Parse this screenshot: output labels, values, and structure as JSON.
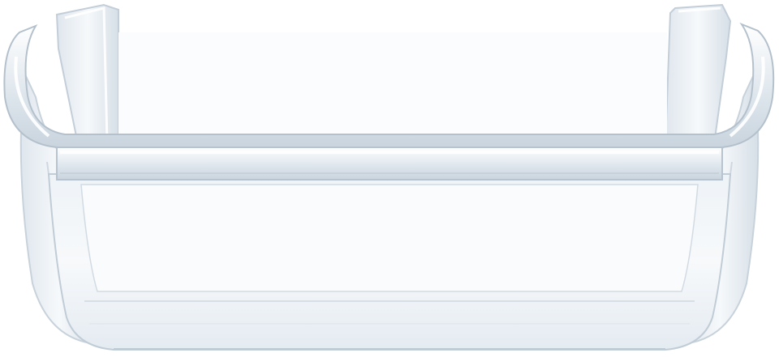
{
  "image": {
    "subject": "clear-plastic-door-bin",
    "background_color": "#ffffff",
    "colors": {
      "plastic_light": "#f4f7fa",
      "plastic_mid": "#dbe3ea",
      "plastic_edge": "#b9c6d2",
      "highlight": "#ffffff"
    }
  }
}
